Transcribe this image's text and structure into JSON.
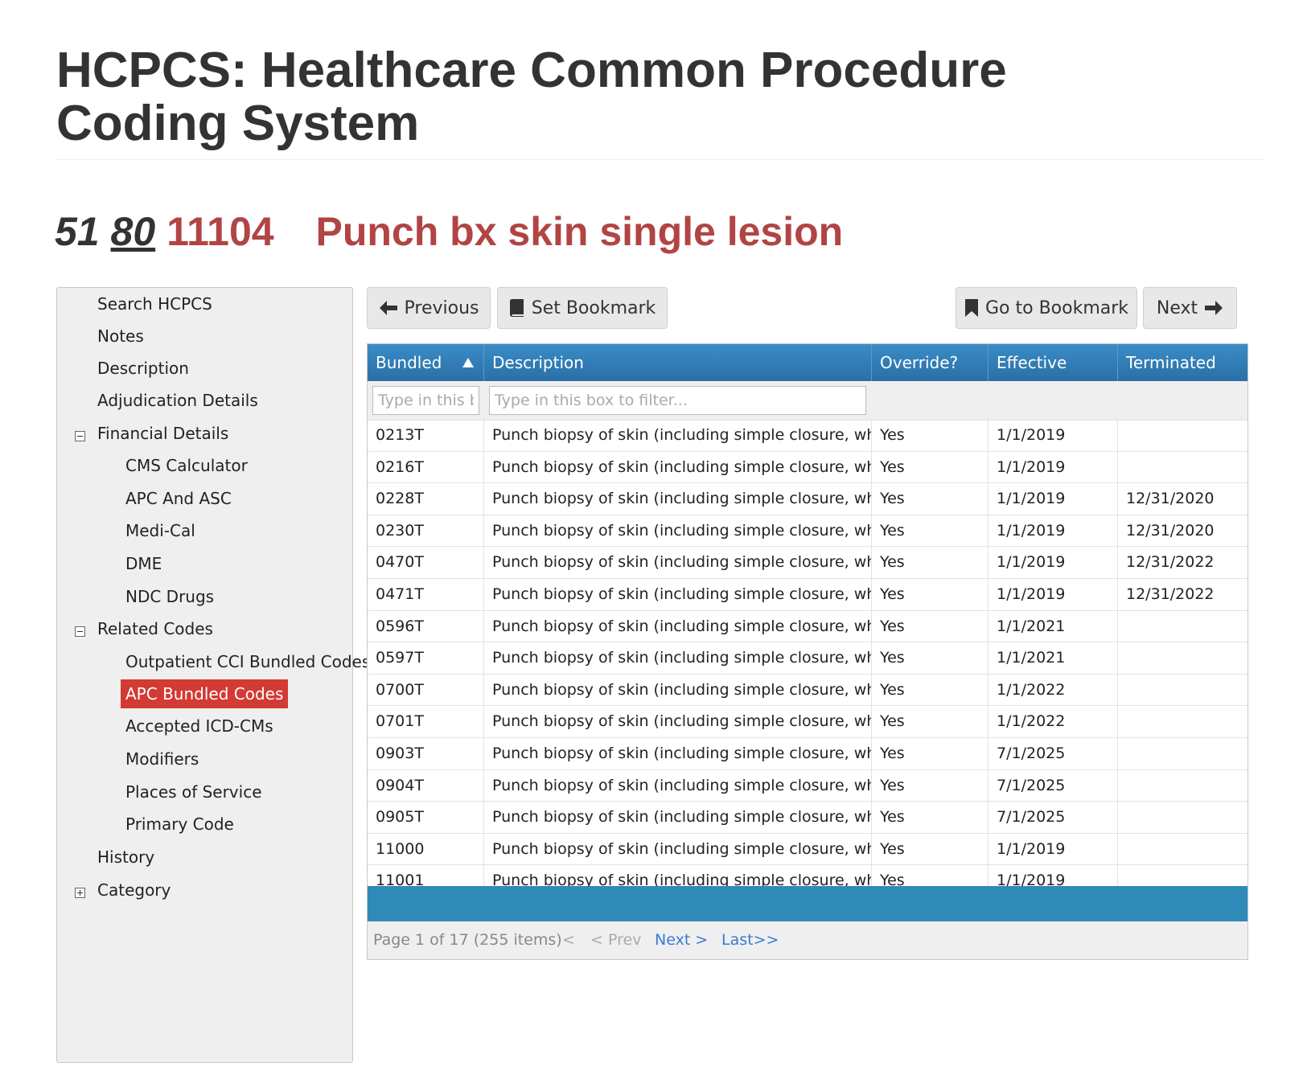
{
  "page": {
    "title": "HCPCS: Healthcare Common Procedure Coding System"
  },
  "code_header": {
    "num1": "51",
    "num2": "80",
    "code": "11104",
    "description": "Punch bx skin single lesion"
  },
  "sidebar": {
    "items": [
      {
        "label": "Search HCPCS"
      },
      {
        "label": "Notes"
      },
      {
        "label": "Description"
      },
      {
        "label": "Adjudication Details"
      },
      {
        "label": "Financial Details"
      },
      {
        "label": "CMS Calculator"
      },
      {
        "label": "APC And ASC"
      },
      {
        "label": "Medi-Cal"
      },
      {
        "label": "DME"
      },
      {
        "label": "NDC Drugs"
      },
      {
        "label": "Related Codes"
      },
      {
        "label": "Outpatient CCI Bundled Codes"
      },
      {
        "label": "APC Bundled Codes"
      },
      {
        "label": "Accepted ICD-CMs"
      },
      {
        "label": "Modifiers"
      },
      {
        "label": "Places of Service"
      },
      {
        "label": "Primary Code"
      },
      {
        "label": "History"
      },
      {
        "label": "Category"
      }
    ]
  },
  "toolbar": {
    "previous_label": "Previous",
    "set_bookmark_label": "Set Bookmark",
    "go_to_bookmark_label": "Go to Bookmark",
    "next_label": "Next"
  },
  "grid": {
    "columns": [
      "Bundled",
      "Description",
      "Override?",
      "Effective",
      "Terminated"
    ],
    "filter_placeholder_bundled": "Type in this box to filter...",
    "filter_placeholder_description": "Type in this box to filter...",
    "rows": [
      {
        "bundled": "0213T",
        "description": "Punch biopsy of skin (including simple closure, when performed); single lesion",
        "override": "Yes",
        "effective": "1/1/2019",
        "terminated": ""
      },
      {
        "bundled": "0216T",
        "description": "Punch biopsy of skin (including simple closure, when performed); single lesion",
        "override": "Yes",
        "effective": "1/1/2019",
        "terminated": ""
      },
      {
        "bundled": "0228T",
        "description": "Punch biopsy of skin (including simple closure, when performed); single lesion",
        "override": "Yes",
        "effective": "1/1/2019",
        "terminated": "12/31/2020"
      },
      {
        "bundled": "0230T",
        "description": "Punch biopsy of skin (including simple closure, when performed); single lesion",
        "override": "Yes",
        "effective": "1/1/2019",
        "terminated": "12/31/2020"
      },
      {
        "bundled": "0470T",
        "description": "Punch biopsy of skin (including simple closure, when performed); single lesion",
        "override": "Yes",
        "effective": "1/1/2019",
        "terminated": "12/31/2022"
      },
      {
        "bundled": "0471T",
        "description": "Punch biopsy of skin (including simple closure, when performed); single lesion",
        "override": "Yes",
        "effective": "1/1/2019",
        "terminated": "12/31/2022"
      },
      {
        "bundled": "0596T",
        "description": "Punch biopsy of skin (including simple closure, when performed); single lesion",
        "override": "Yes",
        "effective": "1/1/2021",
        "terminated": ""
      },
      {
        "bundled": "0597T",
        "description": "Punch biopsy of skin (including simple closure, when performed); single lesion",
        "override": "Yes",
        "effective": "1/1/2021",
        "terminated": ""
      },
      {
        "bundled": "0700T",
        "description": "Punch biopsy of skin (including simple closure, when performed); single lesion",
        "override": "Yes",
        "effective": "1/1/2022",
        "terminated": ""
      },
      {
        "bundled": "0701T",
        "description": "Punch biopsy of skin (including simple closure, when performed); single lesion",
        "override": "Yes",
        "effective": "1/1/2022",
        "terminated": ""
      },
      {
        "bundled": "0903T",
        "description": "Punch biopsy of skin (including simple closure, when performed); single lesion",
        "override": "Yes",
        "effective": "7/1/2025",
        "terminated": ""
      },
      {
        "bundled": "0904T",
        "description": "Punch biopsy of skin (including simple closure, when performed); single lesion",
        "override": "Yes",
        "effective": "7/1/2025",
        "terminated": ""
      },
      {
        "bundled": "0905T",
        "description": "Punch biopsy of skin (including simple closure, when performed); single lesion",
        "override": "Yes",
        "effective": "7/1/2025",
        "terminated": ""
      },
      {
        "bundled": "11000",
        "description": "Punch biopsy of skin (including simple closure, when performed); single lesion",
        "override": "Yes",
        "effective": "1/1/2019",
        "terminated": ""
      },
      {
        "bundled": "11001",
        "description": "Punch biopsy of skin (including simple closure, when performed); single lesion",
        "override": "Yes",
        "effective": "1/1/2019",
        "terminated": ""
      }
    ]
  },
  "pager": {
    "info": "Page 1 of 17 (255 items)",
    "first": "<",
    "prev": "< Prev",
    "next": "Next >",
    "last": "Last>>"
  },
  "colors": {
    "accent_red": "#b24444",
    "active_nav": "#d23a33",
    "grid_header": "#2b6fa6",
    "grid_footer": "#2f8ab8",
    "link_blue": "#3a7bd5"
  }
}
